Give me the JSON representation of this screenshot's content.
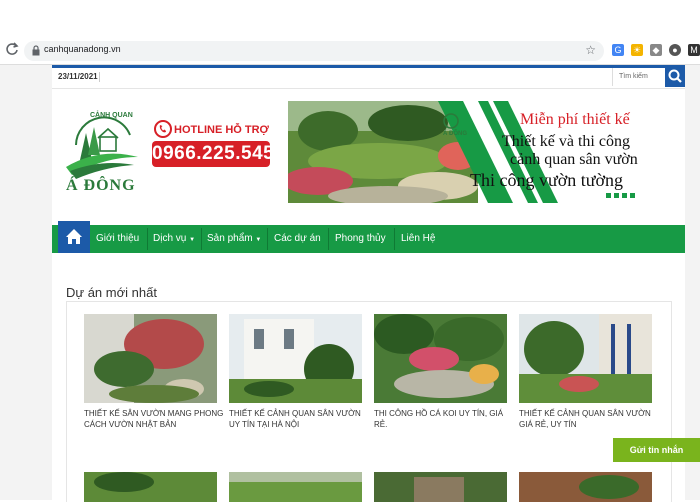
{
  "browser": {
    "url": "canhquanadong.vn",
    "back_icon": "reload-icon",
    "extensions": [
      "translate-icon",
      "sun-icon",
      "shield-icon",
      "user-icon",
      "camera-icon",
      "m-icon"
    ]
  },
  "topbar": {
    "date": "23/11/2021",
    "search_placeholder": "Tìm kiếm"
  },
  "header": {
    "logo_text": "Á ĐÔNG",
    "logo_arc_text": "CẢNH QUAN",
    "hotline_label": "HOTLINE HỖ TRỢ",
    "hotline_number": "0966.225.545"
  },
  "banner": {
    "brand": "Á ĐÔNG",
    "line1": "Miễn phí thiết kế",
    "line2": "Thiết kế và thi công",
    "line3": "cảnh quan sân vườn",
    "line4": "Thi công vườn tường"
  },
  "nav": {
    "items": [
      {
        "label": "Giới thiệu"
      },
      {
        "label": "Dịch vụ"
      },
      {
        "label": "Sản phẩm"
      },
      {
        "label": "Các dự án"
      },
      {
        "label": "Phong thủy"
      },
      {
        "label": "Liên Hệ"
      }
    ]
  },
  "section": {
    "title": "Dự án mới nhất"
  },
  "projects": [
    {
      "title": "THIẾT KẾ SÂN VƯỜN MANG PHONG CÁCH VƯỜN NHẬT BẢN"
    },
    {
      "title": "THIẾT KẾ CẢNH QUAN SÂN VƯỜN UY TÍN TẠI HÀ NỘI"
    },
    {
      "title": "THI CÔNG HỒ CÁ KOI UY TÍN, GIÁ RẺ."
    },
    {
      "title": "THIẾT KẾ CẢNH QUAN SÂN VƯỜN GIÁ RẺ, UY TÍN"
    }
  ],
  "floating": {
    "label": "Gửi tin nhắn"
  },
  "colors": {
    "nav_green": "#179a45",
    "brand_blue": "#1c5aa8",
    "hotline_red": "#d72027",
    "chat_green": "#7ab41d"
  }
}
